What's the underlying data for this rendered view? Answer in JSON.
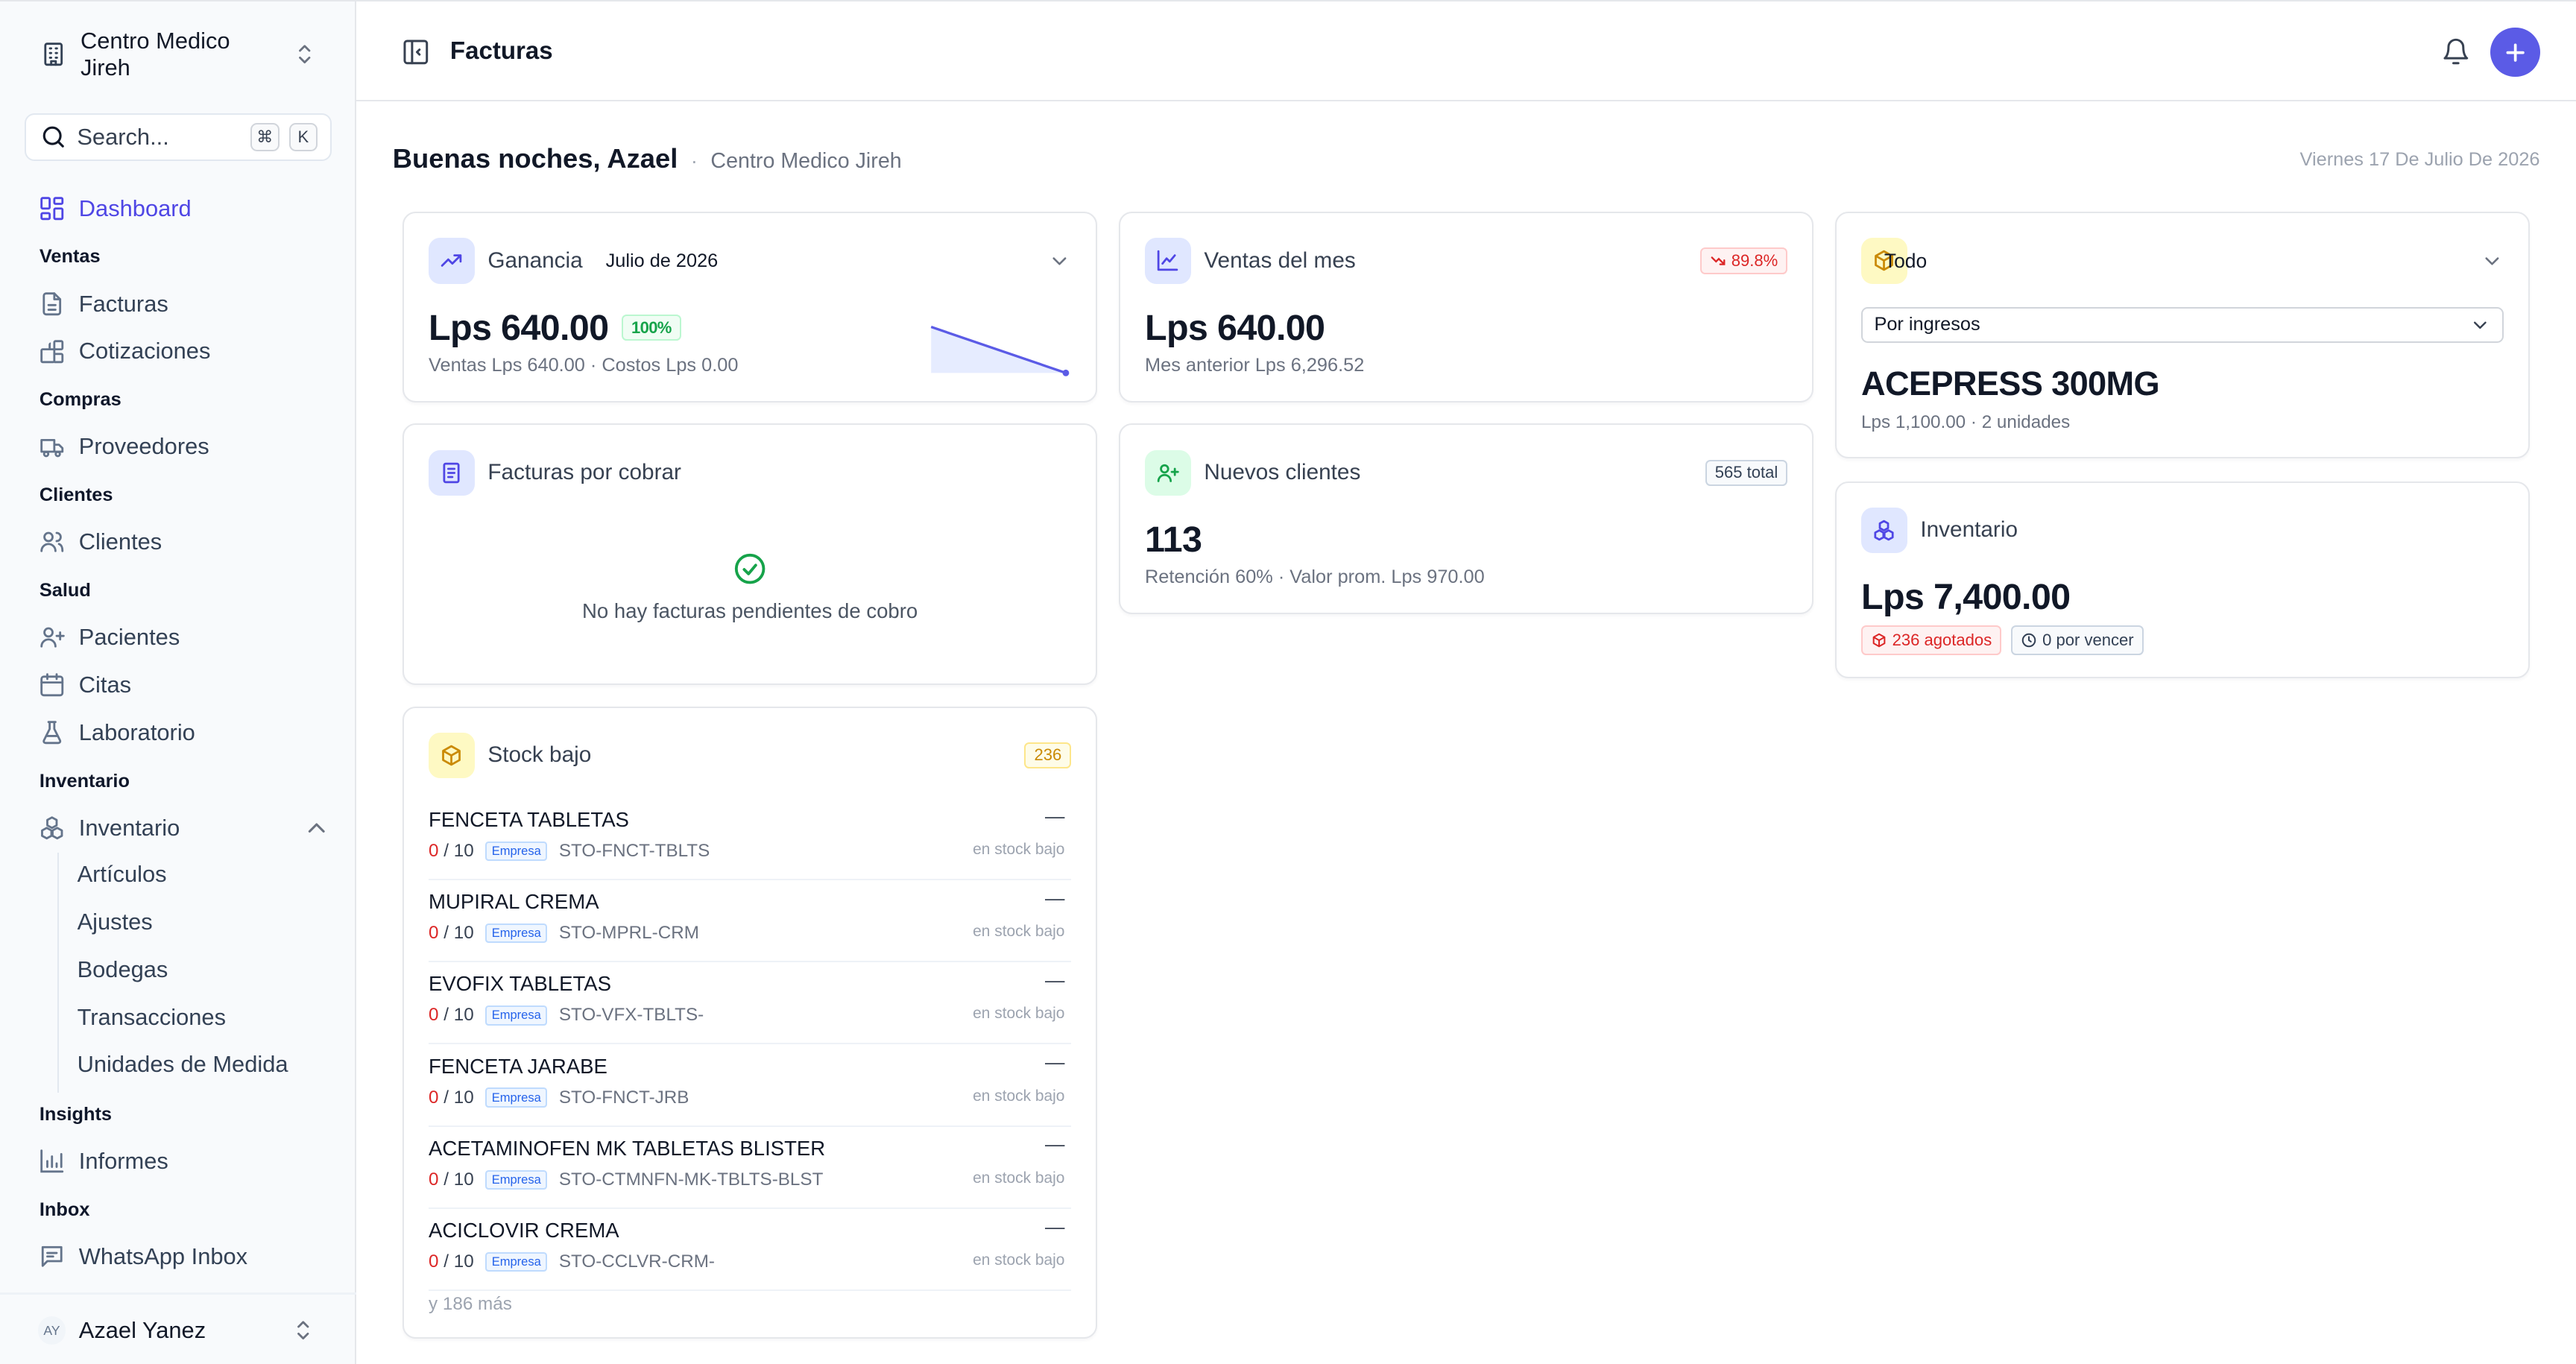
{
  "sidebar": {
    "org_name": "Centro Medico Jireh",
    "search_placeholder": "Search...",
    "kbd_cmd": "⌘",
    "kbd_k": "K",
    "dashboard": "Dashboard",
    "groups": {
      "ventas": "Ventas",
      "compras": "Compras",
      "clientes": "Clientes",
      "salud": "Salud",
      "inventario": "Inventario",
      "insights": "Insights",
      "inbox": "Inbox"
    },
    "items": {
      "facturas": "Facturas",
      "cotizaciones": "Cotizaciones",
      "proveedores": "Proveedores",
      "clientes": "Clientes",
      "pacientes": "Pacientes",
      "citas": "Citas",
      "laboratorio": "Laboratorio",
      "inventario": "Inventario",
      "informes": "Informes",
      "whatsapp": "WhatsApp Inbox"
    },
    "inventario_sub": [
      "Artículos",
      "Ajustes",
      "Bodegas",
      "Transacciones",
      "Unidades de Medida"
    ],
    "user": {
      "initials": "AY",
      "name": "Azael Yanez"
    }
  },
  "topbar": {
    "title": "Facturas"
  },
  "greeting": {
    "hello": "Buenas noches, Azael",
    "separator": "·",
    "org": "Centro Medico Jireh",
    "date": "Viernes 17 De Julio De 2026"
  },
  "ganancia": {
    "title": "Ganancia",
    "period": "Julio de 2026",
    "amount": "Lps 640.00",
    "badge": "100%",
    "detail": "Ventas Lps 640.00 · Costos Lps 0.00",
    "sparkline": [
      1,
      0
    ]
  },
  "ventas_mes": {
    "title": "Ventas del mes",
    "badge": "89.8%",
    "amount": "Lps 640.00",
    "detail": "Mes anterior Lps 6,296.52"
  },
  "todo": {
    "title": "Todo",
    "select_value": "Por ingresos",
    "product": "ACEPRESS 300MG",
    "detail": "Lps 1,100.00 · 2 unidades"
  },
  "facturas_cobrar": {
    "title": "Facturas por cobrar",
    "empty": "No hay facturas pendientes de cobro"
  },
  "nuevos_clientes": {
    "title": "Nuevos clientes",
    "badge": "565 total",
    "count": "113",
    "detail": "Retención 60% · Valor prom. Lps 970.00"
  },
  "inventario": {
    "title": "Inventario",
    "amount": "Lps 7,400.00",
    "agotados": "236 agotados",
    "vencer": "0 por vencer"
  },
  "stock_bajo": {
    "title": "Stock bajo",
    "badge": "236",
    "tag": "Empresa",
    "status": "en stock bajo",
    "dash": "—",
    "items": [
      {
        "name": "FENCETA TABLETAS",
        "qty": "0",
        "max": "/ 10",
        "code": "STO-FNCT-TBLTS"
      },
      {
        "name": "MUPIRAL CREMA",
        "qty": "0",
        "max": "/ 10",
        "code": "STO-MPRL-CRM"
      },
      {
        "name": "EVOFIX TABLETAS",
        "qty": "0",
        "max": "/ 10",
        "code": "STO-VFX-TBLTS-"
      },
      {
        "name": "FENCETA JARABE",
        "qty": "0",
        "max": "/ 10",
        "code": "STO-FNCT-JRB"
      },
      {
        "name": "ACETAMINOFEN MK TABLETAS BLISTER",
        "qty": "0",
        "max": "/ 10",
        "code": "STO-CTMNFN-MK-TBLTS-BLST"
      },
      {
        "name": "ACICLOVIR CREMA",
        "qty": "0",
        "max": "/ 10",
        "code": "STO-CCLVR-CRM-"
      }
    ],
    "more": "y 186 más"
  },
  "colors": {
    "accent": "#4f46e5",
    "danger": "#dc2626",
    "success": "#16a34a"
  }
}
